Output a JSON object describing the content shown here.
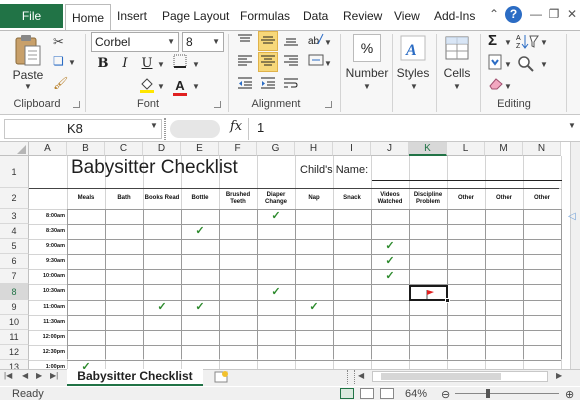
{
  "ribbon": {
    "tabs": [
      "Home",
      "Insert",
      "Page Layout",
      "Formulas",
      "Data",
      "Review",
      "View",
      "Add-Ins"
    ],
    "file_label": "File",
    "groups": {
      "clipboard": "Clipboard",
      "font": "Font",
      "alignment": "Alignment",
      "editing": "Editing"
    },
    "paste_label": "Paste",
    "font_name": "Corbel",
    "font_size": "8",
    "number_label": "Number",
    "number_symbol": "%",
    "styles_label": "Styles",
    "cells_label": "Cells",
    "sum_symbol": "Σ",
    "bold": "B",
    "italic": "I",
    "underline": "U",
    "font_color": "A"
  },
  "formula_bar": {
    "name_box": "K8",
    "fx": "fx",
    "value": "1"
  },
  "sheet": {
    "columns": [
      "A",
      "B",
      "C",
      "D",
      "E",
      "F",
      "G",
      "H",
      "I",
      "J",
      "K",
      "L",
      "M",
      "N"
    ],
    "rows": [
      "1",
      "2",
      "3",
      "4",
      "5",
      "6",
      "7",
      "8",
      "9",
      "10",
      "11",
      "12",
      "13"
    ],
    "title": "Babysitter Checklist",
    "child_name_label": "Child's Name:",
    "activity_headers": [
      "Meals",
      "Bath",
      "Books Read",
      "Bottle",
      "Brushed Teeth",
      "Diaper Change",
      "Nap",
      "Snack",
      "Videos Watched",
      "Discipline Problem",
      "Other",
      "Other",
      "Other"
    ],
    "times": [
      "8:00am",
      "8:30am",
      "9:00am",
      "9:30am",
      "10:00am",
      "10:30am",
      "11:00am",
      "11:30am",
      "12:00pm",
      "12:30pm",
      "1:00pm"
    ],
    "check_symbol": "✓"
  },
  "sheet_tab": "Babysitter Checklist",
  "status": {
    "ready": "Ready",
    "zoom": "64%"
  },
  "colors": {
    "accent": "#217346",
    "check": "#2e8b2e"
  }
}
